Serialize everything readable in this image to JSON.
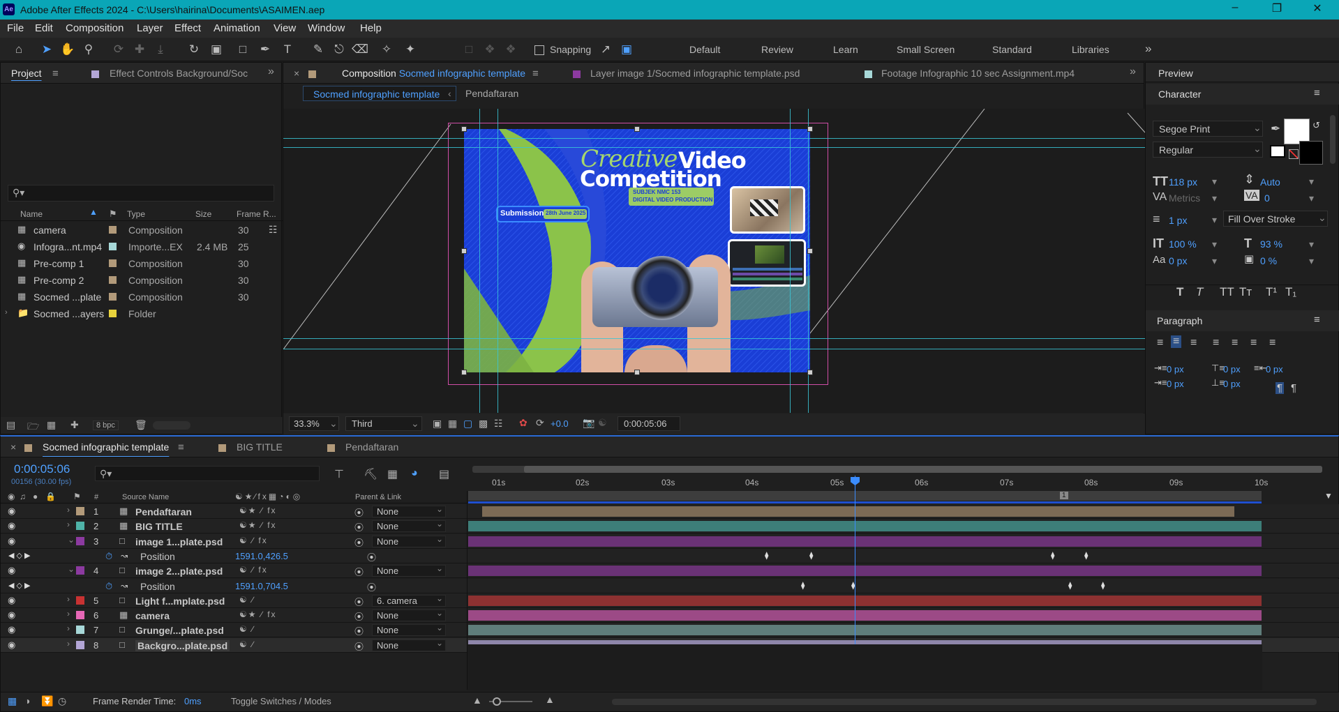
{
  "window": {
    "app_icon": "Ae",
    "title": "Adobe After Effects 2024 - C:\\Users\\hairina\\Documents\\ASAIMEN.aep",
    "controls": [
      "minimize-icon",
      "maximize-icon",
      "close-icon"
    ]
  },
  "menu": [
    "File",
    "Edit",
    "Composition",
    "Layer",
    "Effect",
    "Animation",
    "View",
    "Window",
    "Help"
  ],
  "toolbar": {
    "snapping_label": "Snapping",
    "workspaces": [
      "Default",
      "Review",
      "Learn",
      "Small Screen",
      "Standard",
      "Libraries"
    ],
    "more": "»"
  },
  "project_panel": {
    "tab": "Project",
    "tab2": "Effect Controls Background/Soc",
    "columns": [
      "Name",
      "Type",
      "Size",
      "Frame R..."
    ],
    "items": [
      {
        "name": "camera",
        "type": "Composition",
        "size": "",
        "fps": "30",
        "color": "#b29a7a",
        "icon": "composition-icon"
      },
      {
        "name": "Infogra...nt.mp4",
        "type": "Importe...EX",
        "size": "2.4 MB",
        "fps": "25",
        "color": "#a7d8d8",
        "icon": "footage-icon"
      },
      {
        "name": "Pre-comp 1",
        "type": "Composition",
        "size": "",
        "fps": "30",
        "color": "#b29a7a",
        "icon": "composition-icon"
      },
      {
        "name": "Pre-comp 2",
        "type": "Composition",
        "size": "",
        "fps": "30",
        "color": "#b29a7a",
        "icon": "composition-icon"
      },
      {
        "name": "Socmed ...plate",
        "type": "Composition",
        "size": "",
        "fps": "30",
        "color": "#b29a7a",
        "icon": "composition-icon"
      },
      {
        "name": "Socmed ...ayers",
        "type": "Folder",
        "size": "",
        "fps": "",
        "color": "#e8d23c",
        "icon": "folder-icon"
      }
    ],
    "bpc": "8 bpc"
  },
  "composition_panel": {
    "tab_label_prefix": "Composition",
    "tab_label_name": "Socmed infographic template",
    "layer_tab": "Layer  image 1/Socmed infographic template.psd",
    "footage_tab": "Footage  Infographic 10 sec Assignment.mp4",
    "breadcrumbs": [
      "Socmed infographic template",
      "Pendaftaran"
    ],
    "zoom": "33.3%",
    "resolution": "Third",
    "exposure": "+0.0",
    "timecode": "0:00:05:06"
  },
  "poster": {
    "title_script": "Creative",
    "title_bold": "Video",
    "title_line2": "Competition",
    "subject_line1": "SUBJEK NMC 153",
    "subject_line2": "DIGITAL VIDEO PRODUCTION",
    "submission_label": "Submission",
    "submission_date": "28th June 2025"
  },
  "preview_panel": {
    "title": "Preview"
  },
  "character_panel": {
    "title": "Character",
    "font": "Segoe Print",
    "style": "Regular",
    "font_size": "118 px",
    "leading": "Auto",
    "kerning": "Metrics",
    "tracking": "0",
    "stroke_width": "1 px",
    "stroke_type": "Fill Over Stroke",
    "vertical_scale": "100 %",
    "horizontal_scale": "93 %",
    "baseline_shift": "0 px",
    "tsume": "0 %",
    "fill_color": "#ffffff"
  },
  "paragraph_panel": {
    "title": "Paragraph",
    "indent_left": "0 px",
    "indent_right": "0 px",
    "space_before": "0 px",
    "space_after": "0 px",
    "first_line": "0 px"
  },
  "timeline": {
    "tabs": [
      "Socmed infographic template",
      "BIG TITLE",
      "Pendaftaran"
    ],
    "timecode": "0:00:05:06",
    "frames": "00156 (30.00 fps)",
    "col_headers": {
      "num": "#",
      "source": "Source Name",
      "parent": "Parent & Link"
    },
    "ruler": [
      "01s",
      "02s",
      "03s",
      "04s",
      "05s",
      "06s",
      "07s",
      "08s",
      "09s",
      "10s"
    ],
    "marker": "1",
    "layers": [
      {
        "num": "1",
        "name": "Pendaftaran",
        "label": "#b29a7a",
        "bar": "#7c6a55",
        "parent": "None",
        "type": "comp",
        "fx": true
      },
      {
        "num": "2",
        "name": "BIG TITLE",
        "label": "#4fb3a8",
        "bar": "#3d7e79",
        "parent": "None",
        "type": "comp",
        "fx": true
      },
      {
        "num": "3",
        "name": "image 1...plate.psd",
        "label": "#8c3aa0",
        "bar": "#6a3276",
        "parent": "None",
        "type": "psd",
        "fx": true,
        "open": true
      },
      {
        "num": "",
        "name": "Position",
        "label": "",
        "bar": "",
        "parent": "",
        "type": "prop",
        "value": "1591.0,426.5"
      },
      {
        "num": "4",
        "name": "image 2...plate.psd",
        "label": "#8c3aa0",
        "bar": "#6a3276",
        "parent": "None",
        "type": "psd",
        "fx": true,
        "open": true
      },
      {
        "num": "",
        "name": "Position",
        "label": "",
        "bar": "",
        "parent": "",
        "type": "prop",
        "value": "1591.0,704.5"
      },
      {
        "num": "5",
        "name": "Light f...mplate.psd",
        "label": "#c83232",
        "bar": "#8d3131",
        "parent": "6. camera",
        "type": "psd",
        "fx": false
      },
      {
        "num": "6",
        "name": "camera",
        "label": "#e667b6",
        "bar": "#9c4a86",
        "parent": "None",
        "type": "comp",
        "fx": true
      },
      {
        "num": "7",
        "name": "Grunge/...plate.psd",
        "label": "#a7d8d8",
        "bar": "#5f7d7b",
        "parent": "None",
        "type": "psd",
        "fx": false
      },
      {
        "num": "8",
        "name": "Backgro...plate.psd",
        "label": "#b3a6d6",
        "bar": "#8e86aa",
        "parent": "None",
        "type": "psd",
        "fx": false
      }
    ],
    "footer": {
      "render_label": "Frame Render Time:",
      "render_value": "0ms",
      "toggle": "Toggle Switches / Modes"
    }
  }
}
